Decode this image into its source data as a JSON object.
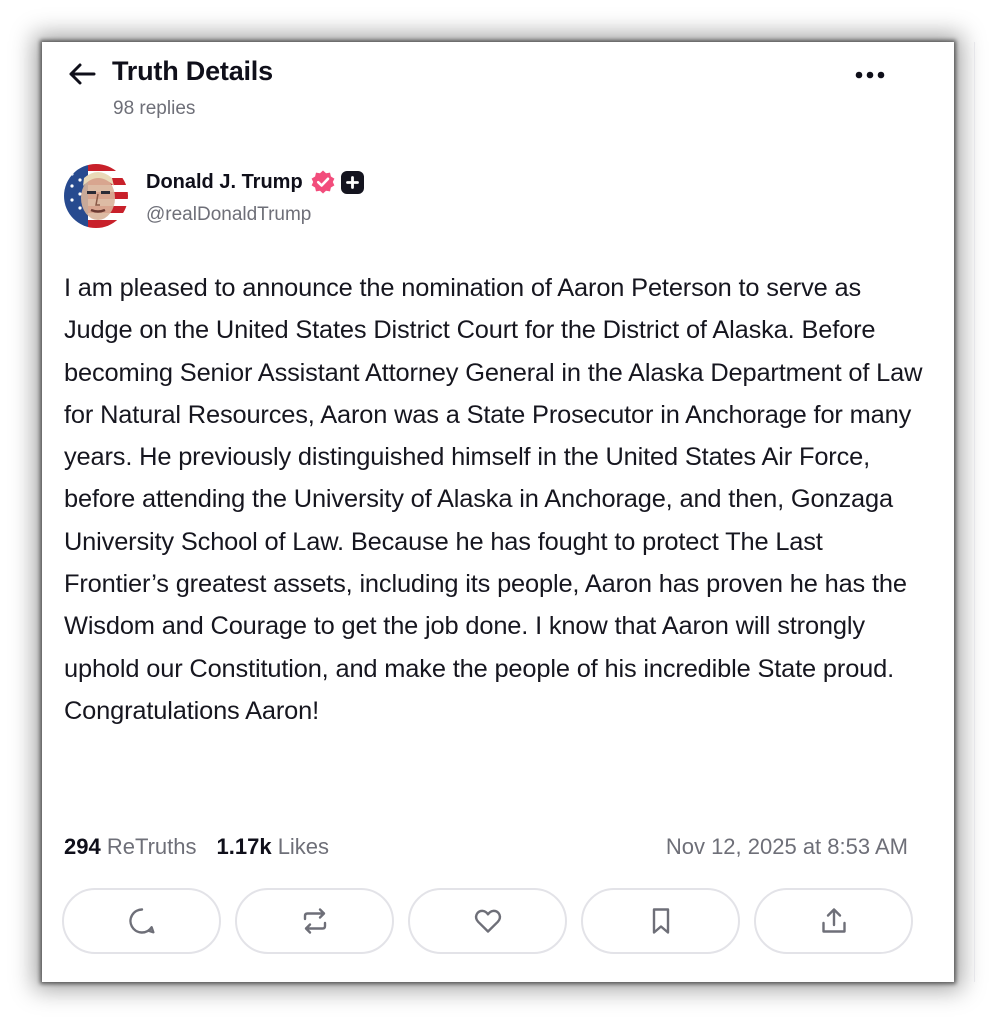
{
  "header": {
    "title": "Truth Details",
    "replies": "98 replies"
  },
  "author": {
    "name": "Donald J. Trump",
    "handle": "@realDonaldTrump",
    "verified_color": "#f24d7c"
  },
  "post": {
    "text": "I am pleased to announce the nomination of Aaron Peterson to serve as Judge on the United States District Court for the District of Alaska. Before becoming Senior Assistant Attorney General in the Alaska Department of Law for Natural Resources, Aaron was a State Prosecutor in Anchorage for many years. He previously distinguished himself in the United States Air Force, before attending the University of Alaska in Anchorage, and then, Gonzaga University School of Law. Because he has fought to protect The Last Frontier’s greatest assets, including its people, Aaron has proven he has the Wisdom and Courage to get the job done. I know that Aaron will strongly uphold our Constitution, and make the people of his incredible State proud. Congratulations Aaron!",
    "retruths_count": "294",
    "retruths_label": "ReTruths",
    "likes_count": "1.17k",
    "likes_label": "Likes",
    "timestamp": "Nov 12, 2025 at 8:53 AM"
  },
  "actions": [
    {
      "icon": "reply-icon"
    },
    {
      "icon": "retruth-icon"
    },
    {
      "icon": "heart-icon"
    },
    {
      "icon": "bookmark-icon"
    },
    {
      "icon": "share-icon"
    }
  ]
}
